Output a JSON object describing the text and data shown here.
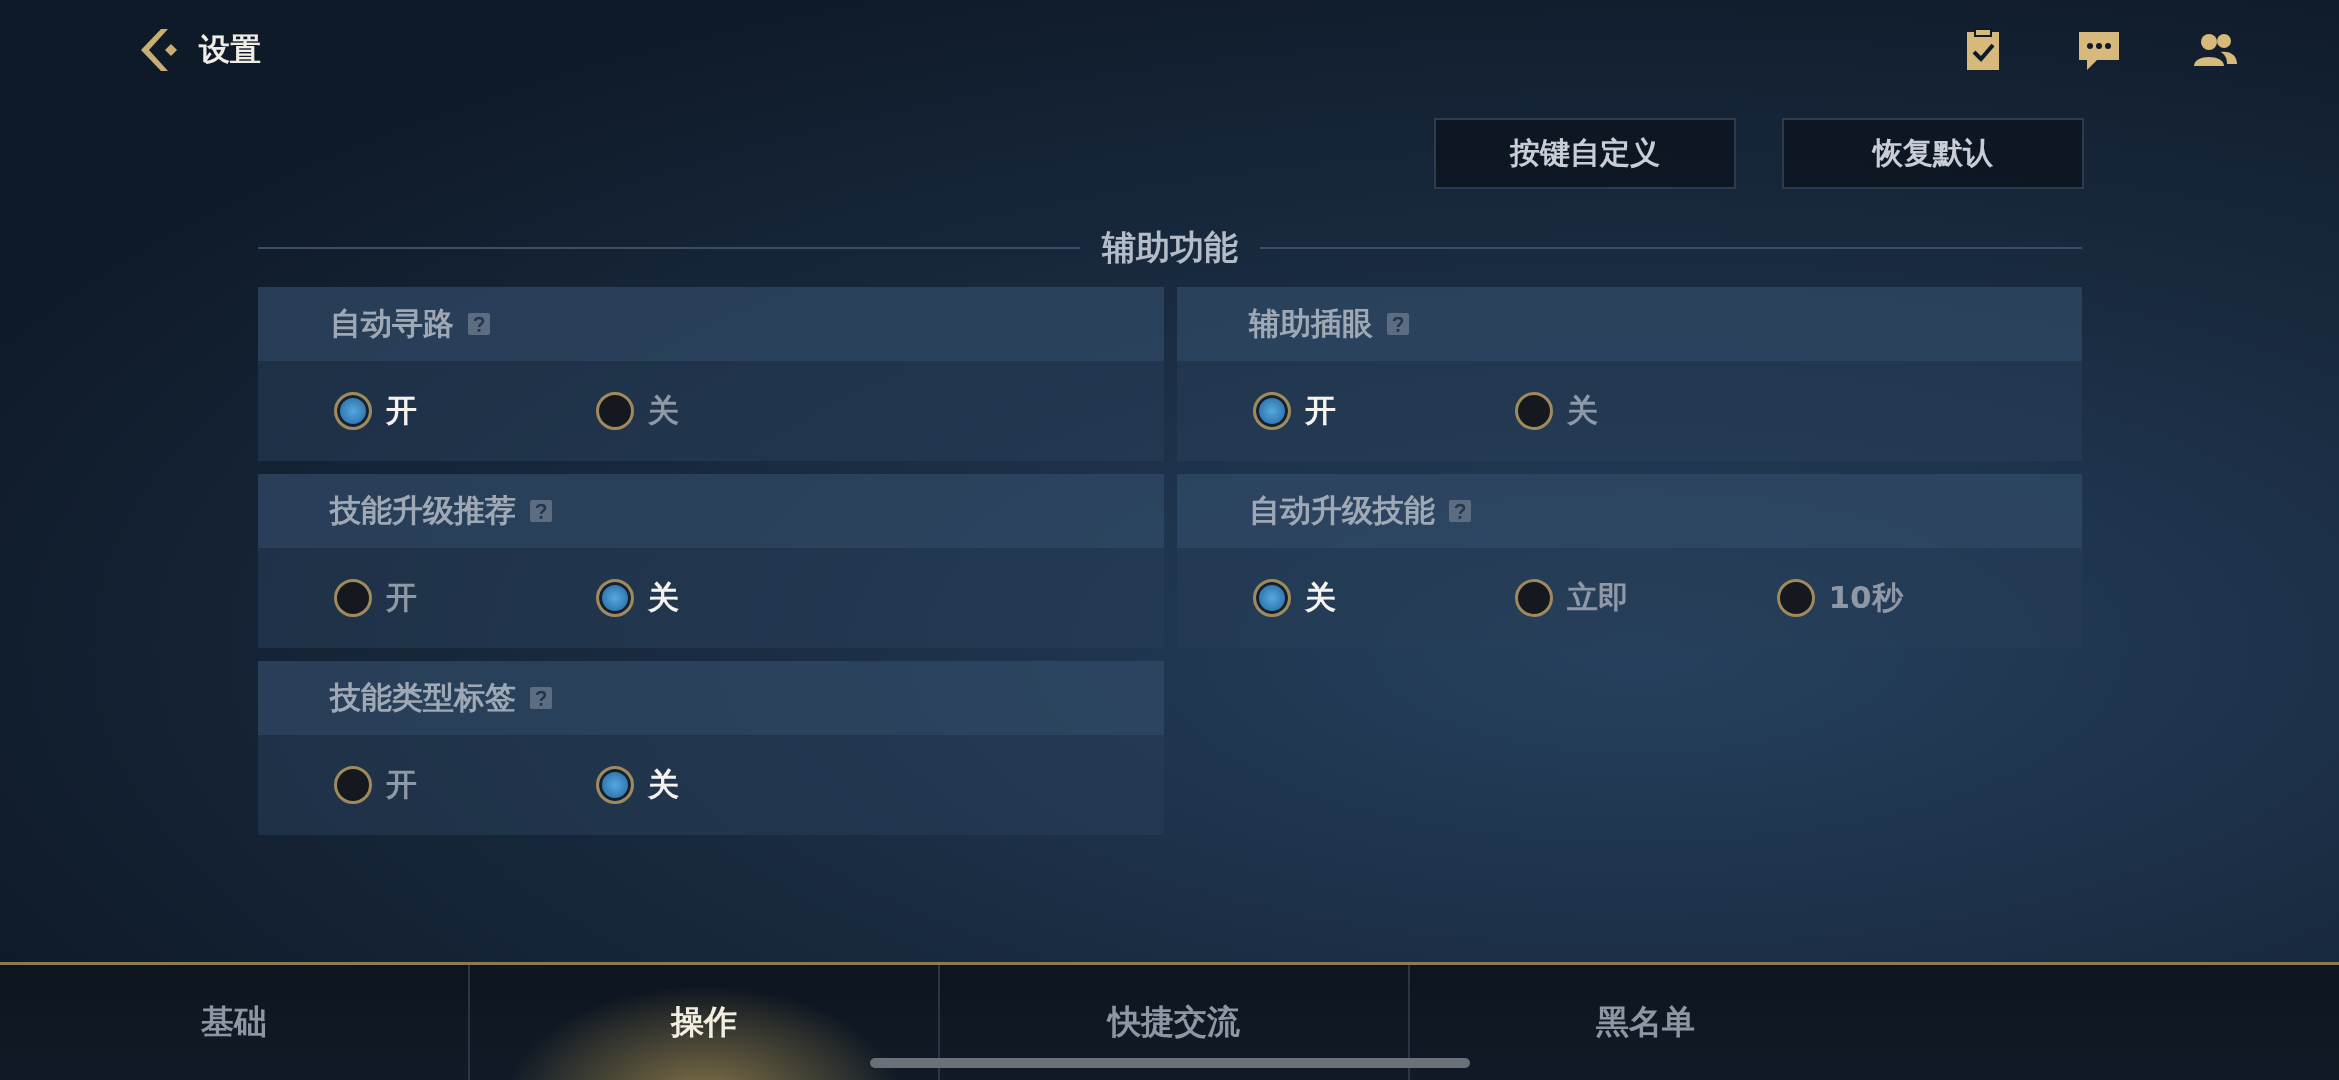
{
  "header": {
    "title": "设置"
  },
  "actions": [
    {
      "label": "按键自定义"
    },
    {
      "label": "恢复默认"
    }
  ],
  "section": {
    "title": "辅助功能"
  },
  "settings": [
    {
      "title": "自动寻路",
      "options": [
        {
          "label": "开",
          "selected": true
        },
        {
          "label": "关",
          "selected": false
        }
      ]
    },
    {
      "title": "辅助插眼",
      "options": [
        {
          "label": "开",
          "selected": true
        },
        {
          "label": "关",
          "selected": false
        }
      ]
    },
    {
      "title": "技能升级推荐",
      "options": [
        {
          "label": "开",
          "selected": false
        },
        {
          "label": "关",
          "selected": true
        }
      ]
    },
    {
      "title": "自动升级技能",
      "options": [
        {
          "label": "关",
          "selected": true
        },
        {
          "label": "立即",
          "selected": false
        },
        {
          "label": "10秒",
          "selected": false
        }
      ]
    },
    {
      "title": "技能类型标签",
      "options": [
        {
          "label": "开",
          "selected": false
        },
        {
          "label": "关",
          "selected": true
        }
      ]
    }
  ],
  "tabs": [
    {
      "label": "基础",
      "selected": false
    },
    {
      "label": "操作",
      "selected": true
    },
    {
      "label": "快捷交流",
      "selected": false
    },
    {
      "label": "黑名单",
      "selected": false
    }
  ]
}
